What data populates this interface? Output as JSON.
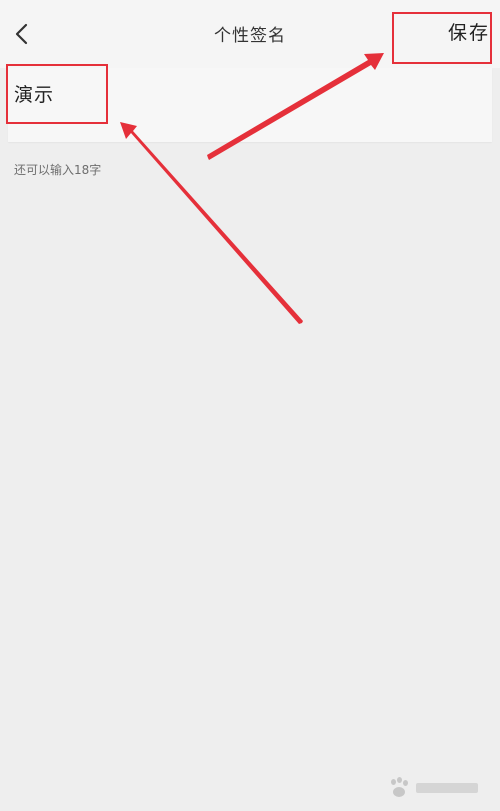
{
  "header": {
    "title": "个性签名",
    "save_label": "保存",
    "back_icon": "chevron-left-icon"
  },
  "signature": {
    "value": "演示"
  },
  "counter": {
    "text": "还可以输入18字"
  },
  "colors": {
    "annotation_red": "#e5303a",
    "background": "#eeeeee",
    "text_primary": "#222222",
    "text_secondary": "#6e6e6e"
  }
}
